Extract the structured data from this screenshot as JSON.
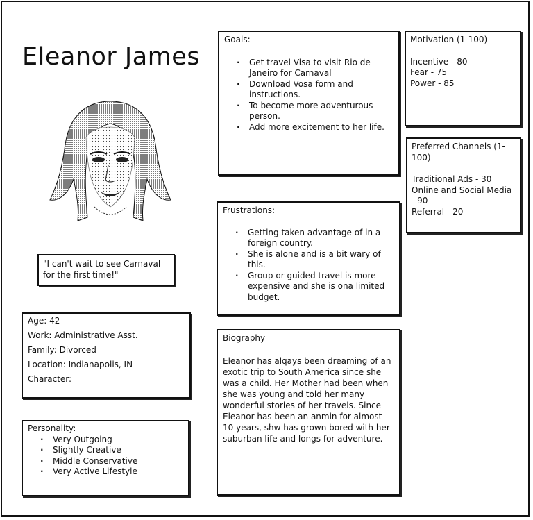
{
  "persona": {
    "name": "Eleanor James",
    "quote": "\"I can't wait to see Carnaval for the first time!\""
  },
  "demographics": {
    "age": "Age: 42",
    "work": "Work: Administrative Asst.",
    "family": "Family: Divorced",
    "location": "Location: Indianapolis, IN",
    "character": "Character:"
  },
  "personality": {
    "label": "Personality:",
    "items": [
      "Very Outgoing",
      "Slightly Creative",
      "Middle Conservative",
      "Very Active Lifestyle"
    ]
  },
  "goals": {
    "label": "Goals:",
    "items": [
      "Get travel Visa to visit Rio de Janeiro for Carnaval",
      "Download Vosa form and instructions.",
      "To become more adventurous person.",
      "Add more excitement to her life."
    ]
  },
  "frustrations": {
    "label": "Frustrations:",
    "items": [
      "Getting taken advantage of in a foreign country.",
      "She is alone and is a bit wary of this.",
      "Group or guided travel is more expensive and she is ona limited budget."
    ]
  },
  "biography": {
    "label": "Biography",
    "text": "Eleanor has alqays been dreaming of an exotic trip to South America since she was a child. Her Mother had been when she was young and told her many wonderful stories of her travels. Since Eleanor has  been an anmin for almost 10 years, shw has grown bored with her suburban life and longs for adventure."
  },
  "motivation": {
    "label": "Motivation (1-100)",
    "items": [
      "Incentive - 80",
      "Fear - 75",
      "Power - 85"
    ]
  },
  "channels": {
    "label": "Preferred Channels (1-100)",
    "items": [
      "Traditional Ads - 30",
      "Online and Social Media - 90",
      "Referral - 20"
    ]
  }
}
